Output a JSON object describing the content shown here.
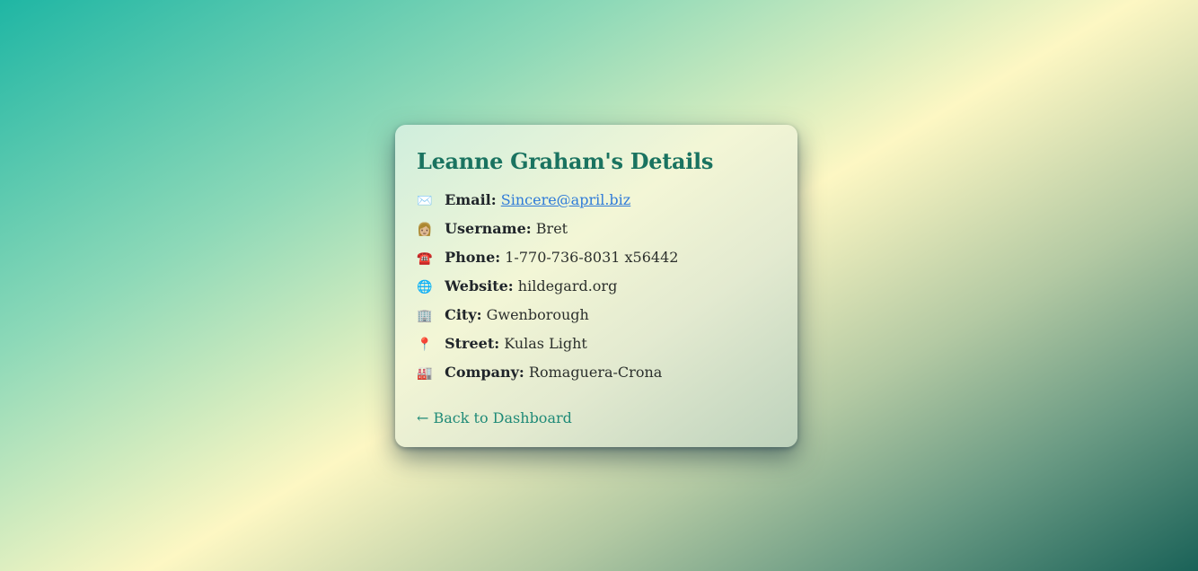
{
  "card": {
    "title": "Leanne Graham's Details",
    "fields": [
      {
        "icon": "✉️",
        "icon_name": "envelope-icon",
        "label": "Email:",
        "value": "Sincere@april.biz",
        "is_link": true
      },
      {
        "icon": "👩🏼",
        "icon_name": "person-icon",
        "label": "Username:",
        "value": "Bret"
      },
      {
        "icon": "☎️",
        "icon_name": "telephone-icon",
        "label": "Phone:",
        "value": "1-770-736-8031 x56442"
      },
      {
        "icon": "🌐",
        "icon_name": "globe-icon",
        "label": "Website:",
        "value": "hildegard.org"
      },
      {
        "icon": "🏢",
        "icon_name": "office-building-icon",
        "label": "City:",
        "value": "Gwenborough"
      },
      {
        "icon": "📍",
        "icon_name": "map-pin-icon",
        "label": "Street:",
        "value": "Kulas Light"
      },
      {
        "icon": "🏭",
        "icon_name": "factory-icon",
        "label": "Company:",
        "value": "Romaguera-Crona"
      }
    ],
    "back_link": "← Back to Dashboard"
  },
  "colors": {
    "title": "#1a7360",
    "link": "#2f7bd8",
    "back_link": "#1f8a77"
  }
}
